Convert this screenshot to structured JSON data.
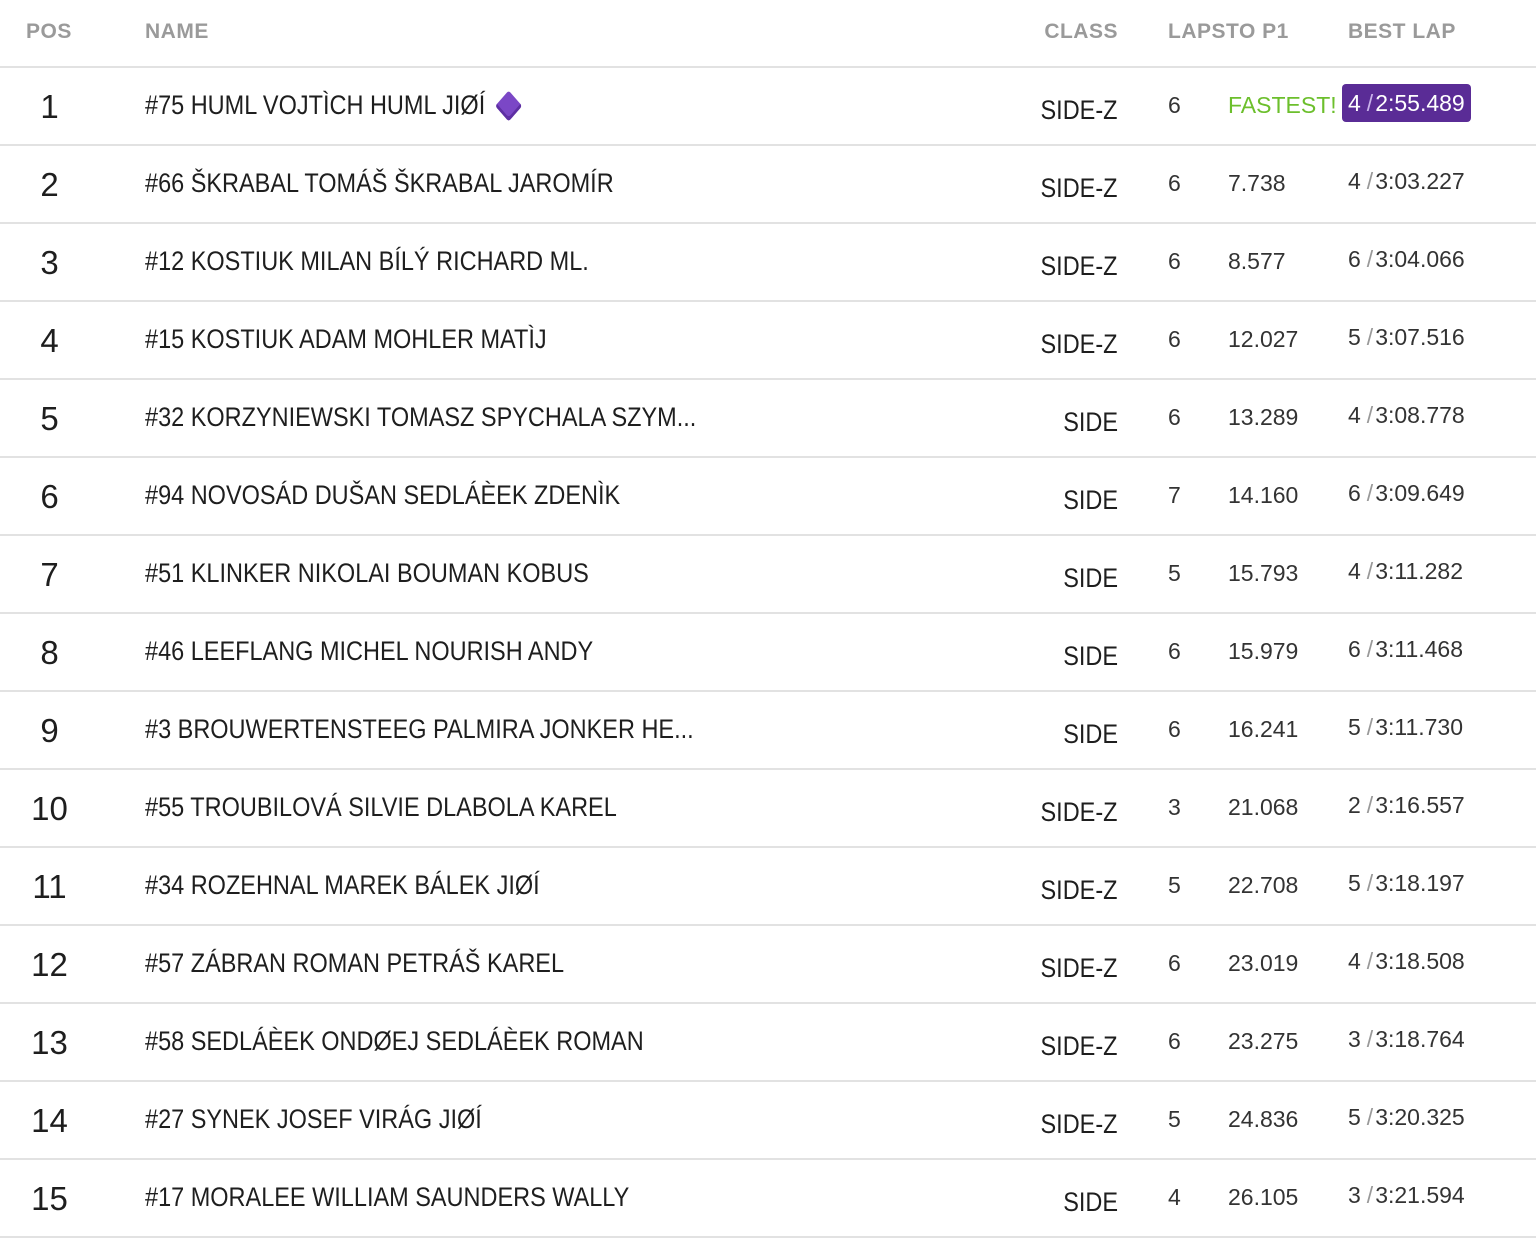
{
  "columns": {
    "pos": "POS",
    "name": "NAME",
    "class": "CLASS",
    "gap": "LAPSTO P1",
    "best": "BEST LAP"
  },
  "accent_colors": {
    "fastest_text": "#6cbf2c",
    "best_lap_highlight": "#5a2c96",
    "diamond_icon": "#7b47c6"
  },
  "rows": [
    {
      "pos": "1",
      "name": "#75 HUML VOJTÌCH HUML JIØÍ",
      "diamond": true,
      "class": "SIDE-Z",
      "laps": "6",
      "gap": "FASTEST!",
      "best_lap_no": "4",
      "sep": "/",
      "best_time": "2:55.489",
      "highlight": true
    },
    {
      "pos": "2",
      "name": "#66 ŠKRABAL TOMÁŠ ŠKRABAL JAROMÍR",
      "class": "SIDE-Z",
      "laps": "6",
      "gap": "7.738",
      "best_lap_no": "4",
      "sep": "/",
      "best_time": "3:03.227"
    },
    {
      "pos": "3",
      "name": "#12 KOSTIUK MILAN BÍLÝ RICHARD ML.",
      "class": "SIDE-Z",
      "laps": "6",
      "gap": "8.577",
      "best_lap_no": "6",
      "sep": "/",
      "best_time": "3:04.066"
    },
    {
      "pos": "4",
      "name": "#15 KOSTIUK ADAM MOHLER MATÌJ",
      "class": "SIDE-Z",
      "laps": "6",
      "gap": "12.027",
      "best_lap_no": "5",
      "sep": "/",
      "best_time": "3:07.516"
    },
    {
      "pos": "5",
      "name": "#32 KORZYNIEWSKI TOMASZ SPYCHALA SZYM...",
      "class": "SIDE",
      "laps": "6",
      "gap": "13.289",
      "best_lap_no": "4",
      "sep": "/",
      "best_time": "3:08.778"
    },
    {
      "pos": "6",
      "name": "#94 NOVOSÁD DUŠAN SEDLÁÈEK ZDENÌK",
      "class": "SIDE",
      "laps": "7",
      "gap": "14.160",
      "best_lap_no": "6",
      "sep": "/",
      "best_time": "3:09.649"
    },
    {
      "pos": "7",
      "name": "#51 KLINKER NIKOLAI BOUMAN KOBUS",
      "class": "SIDE",
      "laps": "5",
      "gap": "15.793",
      "best_lap_no": "4",
      "sep": "/",
      "best_time": "3:11.282"
    },
    {
      "pos": "8",
      "name": "#46 LEEFLANG MICHEL NOURISH ANDY",
      "class": "SIDE",
      "laps": "6",
      "gap": "15.979",
      "best_lap_no": "6",
      "sep": "/",
      "best_time": "3:11.468"
    },
    {
      "pos": "9",
      "name": "#3 BROUWERTENSTEEG PALMIRA JONKER HE...",
      "class": "SIDE",
      "laps": "6",
      "gap": "16.241",
      "best_lap_no": "5",
      "sep": "/",
      "best_time": "3:11.730"
    },
    {
      "pos": "10",
      "name": "#55 TROUBILOVÁ SILVIE DLABOLA KAREL",
      "class": "SIDE-Z",
      "laps": "3",
      "gap": "21.068",
      "best_lap_no": "2",
      "sep": "/",
      "best_time": "3:16.557"
    },
    {
      "pos": "11",
      "name": "#34 ROZEHNAL MAREK BÁLEK JIØÍ",
      "class": "SIDE-Z",
      "laps": "5",
      "gap": "22.708",
      "best_lap_no": "5",
      "sep": "/",
      "best_time": "3:18.197"
    },
    {
      "pos": "12",
      "name": "#57 ZÁBRAN ROMAN PETRÁŠ KAREL",
      "class": "SIDE-Z",
      "laps": "6",
      "gap": "23.019",
      "best_lap_no": "4",
      "sep": "/",
      "best_time": "3:18.508"
    },
    {
      "pos": "13",
      "name": "#58 SEDLÁÈEK ONDØEJ SEDLÁÈEK ROMAN",
      "class": "SIDE-Z",
      "laps": "6",
      "gap": "23.275",
      "best_lap_no": "3",
      "sep": "/",
      "best_time": "3:18.764"
    },
    {
      "pos": "14",
      "name": "#27 SYNEK JOSEF VIRÁG JIØÍ",
      "class": "SIDE-Z",
      "laps": "5",
      "gap": "24.836",
      "best_lap_no": "5",
      "sep": "/",
      "best_time": "3:20.325"
    },
    {
      "pos": "15",
      "name": "#17 MORALEE WILLIAM SAUNDERS WALLY",
      "class": "SIDE",
      "laps": "4",
      "gap": "26.105",
      "best_lap_no": "3",
      "sep": "/",
      "best_time": "3:21.594"
    }
  ]
}
